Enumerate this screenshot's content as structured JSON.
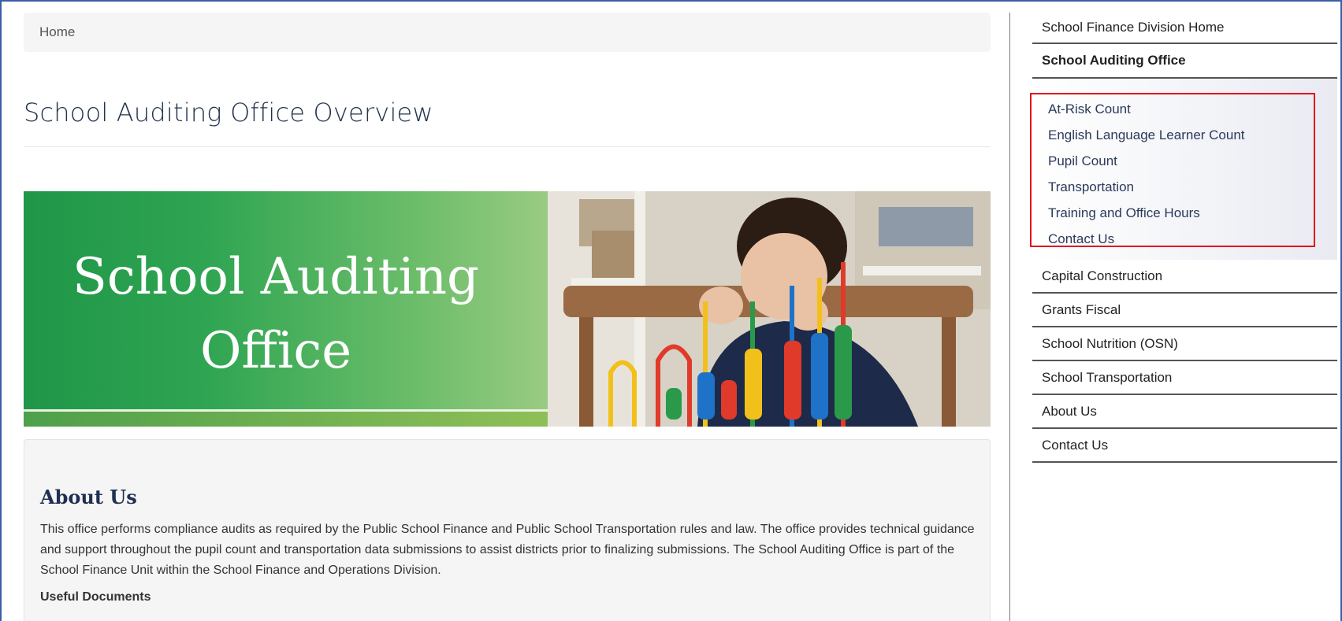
{
  "breadcrumb": {
    "home": "Home"
  },
  "page": {
    "title": "School Auditing Office Overview"
  },
  "hero": {
    "title_line1": "School Auditing",
    "title_line2": "Office"
  },
  "about": {
    "heading": "About Us",
    "text": "This office performs compliance audits as required by the Public School Finance and Public School Transportation rules and law. The office provides technical guidance and support throughout the pupil count and transportation data submissions to assist districts prior to finalizing submissions. The School Auditing Office is part of the School Finance Unit within the School Finance and Operations Division.",
    "useful_documents": "Useful Documents"
  },
  "sidebar": {
    "home": "School Finance Division Home",
    "active": "School Auditing Office",
    "subitems": [
      "At-Risk Count",
      "English Language Learner Count",
      "Pupil Count",
      "Transportation",
      "Training and Office Hours",
      "Contact Us"
    ],
    "items": [
      "Capital Construction",
      "Grants Fiscal",
      "School Nutrition (OSN)",
      "School Transportation",
      "About Us",
      "Contact Us"
    ]
  },
  "colors": {
    "highlight": "#e0111e",
    "accent_green": "#2fa552",
    "title_navy": "#22334d"
  }
}
